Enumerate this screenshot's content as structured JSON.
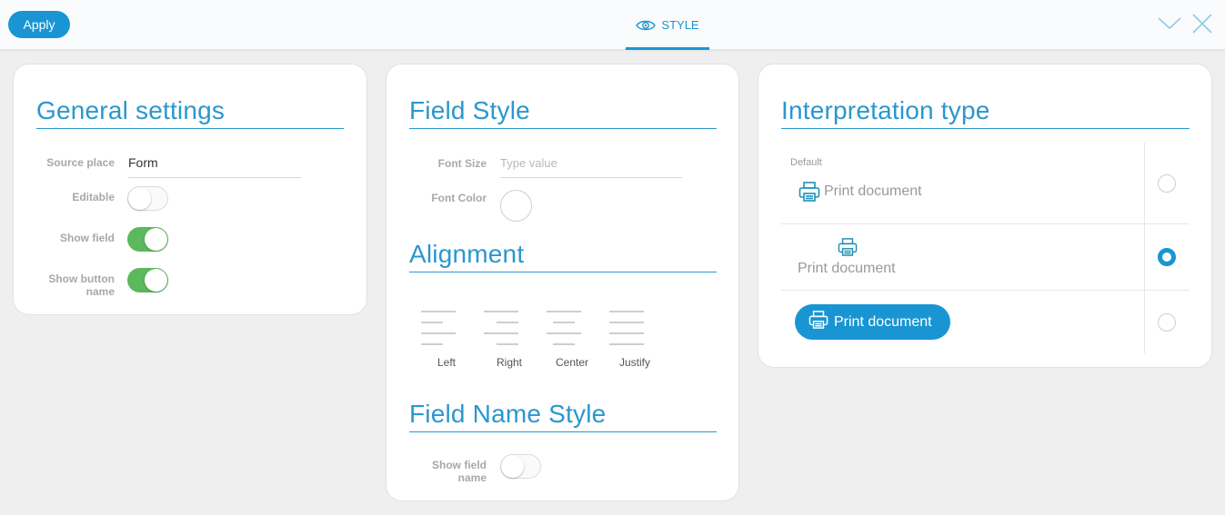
{
  "toolbar": {
    "apply_label": "Apply",
    "tab_label": "STYLE",
    "tab_icon": "eye-icon",
    "collapse_icon": "chevron-down-icon",
    "close_icon": "close-icon",
    "accent_color": "#1a95d3"
  },
  "general": {
    "title": "General settings",
    "source_place_label": "Source place",
    "source_place_value": "Form",
    "editable_label": "Editable",
    "editable_on": false,
    "show_field_label": "Show field",
    "show_field_on": true,
    "show_button_name_label_1": "Show button",
    "show_button_name_label_2": "name",
    "show_button_name_on": true
  },
  "field_style": {
    "title": "Field Style",
    "font_size_label": "Font Size",
    "font_size_placeholder": "Type value",
    "font_color_label": "Font Color"
  },
  "alignment": {
    "title": "Alignment",
    "options": [
      "Left",
      "Right",
      "Center",
      "Justify"
    ]
  },
  "field_name_style": {
    "title": "Field Name Style",
    "show_field_name_label_1": "Show field",
    "show_field_name_label_2": "name",
    "show_field_name_on": false
  },
  "interpretation": {
    "title": "Interpretation type",
    "default_label": "Default",
    "options": [
      {
        "label": "Print document",
        "icon": "printer-icon",
        "style": "icon-inline",
        "selected": false
      },
      {
        "label": "Print document",
        "icon": "printer-icon",
        "style": "icon-above",
        "selected": true
      },
      {
        "label": "Print document",
        "icon": "printer-icon",
        "style": "button",
        "selected": false
      }
    ]
  }
}
